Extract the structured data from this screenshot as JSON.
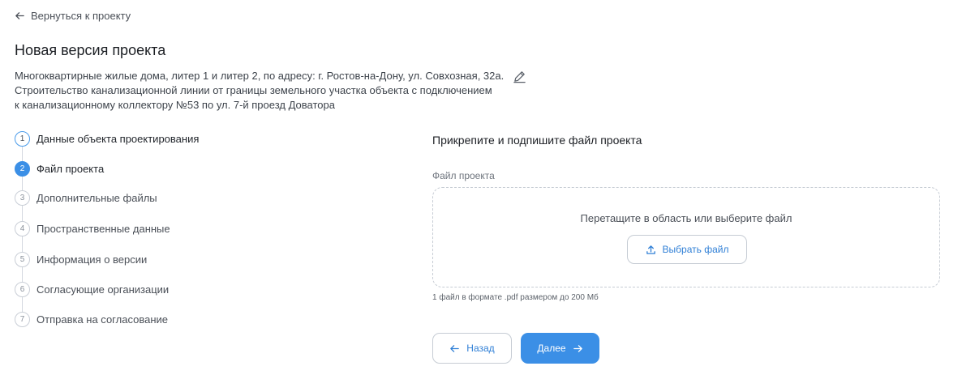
{
  "back_link": {
    "label": "Вернуться к проекту",
    "icon": "arrow-left-icon"
  },
  "page_title": "Новая версия проекта",
  "description": "Многоквартирные жилые дома, литер 1 и литер 2, по адресу: г. Ростов-на-Дону, ул. Совхозная, 32а.\nСтроительство канализационной линии от границы земельного участка объекта с подключением\nк канализационному коллектору №53 по ул. 7-й проезд Доватора",
  "stepper": {
    "steps": [
      {
        "number": "1",
        "label": "Данные объекта проектирования",
        "state": "done"
      },
      {
        "number": "2",
        "label": "Файл проекта",
        "state": "active"
      },
      {
        "number": "3",
        "label": "Дополнительные файлы",
        "state": "pending"
      },
      {
        "number": "4",
        "label": "Пространственные данные",
        "state": "pending"
      },
      {
        "number": "5",
        "label": "Информация о версии",
        "state": "pending"
      },
      {
        "number": "6",
        "label": "Согласующие организации",
        "state": "pending"
      },
      {
        "number": "7",
        "label": "Отправка на согласование",
        "state": "pending"
      }
    ]
  },
  "form": {
    "section_title": "Прикрепите и подпишите файл проекта",
    "field_label": "Файл проекта",
    "dropzone_text": "Перетащите в область или выберите файл",
    "choose_file_label": "Выбрать файл",
    "hint": "1 файл в формате .pdf размером до 200 Мб"
  },
  "actions": {
    "back_label": "Назад",
    "next_label": "Далее"
  },
  "colors": {
    "accent": "#3b8fe6",
    "link": "#2f7fd6",
    "border": "#c6ccd4"
  }
}
